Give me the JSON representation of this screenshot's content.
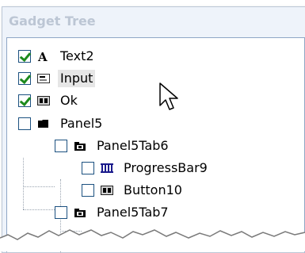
{
  "panel": {
    "title": "Gadget Tree"
  },
  "tree": {
    "items": [
      {
        "label": "Text2",
        "checked": true,
        "icon": "text-icon"
      },
      {
        "label": "Input",
        "checked": true,
        "icon": "input-icon",
        "selected": true
      },
      {
        "label": "Ok",
        "checked": true,
        "icon": "button-icon"
      },
      {
        "label": "Panel5",
        "checked": false,
        "icon": "panel-icon"
      },
      {
        "label": "Panel5Tab6",
        "checked": false,
        "icon": "tab-icon"
      },
      {
        "label": "ProgressBar9",
        "checked": false,
        "icon": "progressbar-icon"
      },
      {
        "label": "Button10",
        "checked": false,
        "icon": "button-icon"
      },
      {
        "label": "Panel5Tab7",
        "checked": false,
        "icon": "tab-icon"
      }
    ]
  },
  "colors": {
    "panel_bg": "#eef3fa",
    "title": "#bcc6d4",
    "checkmark": "#1d8a1d",
    "checkbox_border": "#1c5180",
    "selection": "#e6e6e6"
  }
}
